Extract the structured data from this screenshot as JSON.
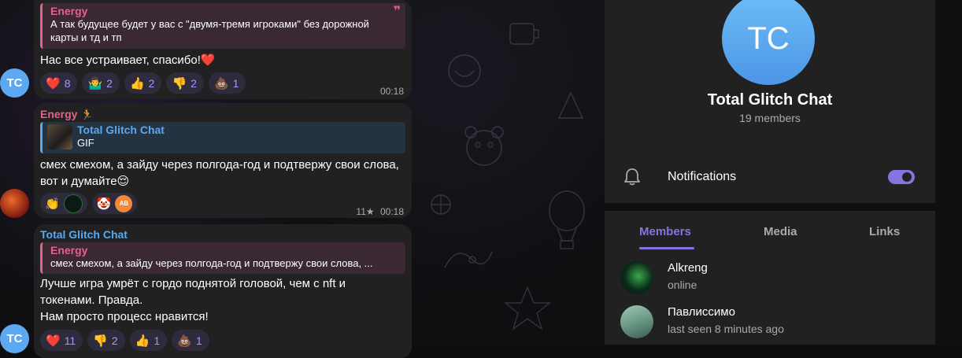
{
  "messages": [
    {
      "reply": {
        "name": "Energy",
        "text": "А так будущее будет у вас с \"двумя-тремя игроками\" без дорожной карты и тд и тп"
      },
      "text": "Нас все устраивает,  спасибо!❤️",
      "reactions": [
        {
          "emoji": "❤️",
          "count": "8"
        },
        {
          "emoji": "🤷‍♂️",
          "count": "2"
        },
        {
          "emoji": "👍",
          "count": "2"
        },
        {
          "emoji": "👎",
          "count": "2"
        },
        {
          "emoji": "💩",
          "count": "1"
        }
      ],
      "time": "00:18",
      "avatar_initials": "TC"
    },
    {
      "sender": "Energy",
      "sender_badge": "🏃",
      "reply": {
        "name": "Total Glitch Chat",
        "text": "GIF"
      },
      "text": "смех смехом, а зайду через полгода-год и подтвержу свои слова, вот и думайте😌",
      "reactions": [
        {
          "emoji": "👏"
        },
        {
          "emoji": "🤡"
        }
      ],
      "reactor_initials": "AB",
      "views": "11★",
      "time": "00:18"
    },
    {
      "sender": "Total Glitch Chat",
      "reply": {
        "name": "Energy",
        "text": "смех смехом, а зайду через полгода-год и подтвержу свои слова, ..."
      },
      "text_lines": [
        "Лучше игра умрёт с гордо поднятой головой, чем с nft и",
        "токенами. Правда.",
        "Нам просто процесс нравится!"
      ],
      "reactions": [
        {
          "emoji": "❤️",
          "count": "11"
        },
        {
          "emoji": "👎",
          "count": "2"
        },
        {
          "emoji": "👍",
          "count": "1"
        },
        {
          "emoji": "💩",
          "count": "1"
        }
      ],
      "avatar_initials": "TC"
    }
  ],
  "panel": {
    "avatar_initials": "TC",
    "title": "Total Glitch Chat",
    "subtitle": "19 members",
    "notifications_label": "Notifications",
    "notifications_on": true,
    "tabs": [
      "Members",
      "Media",
      "Links"
    ],
    "active_tab": "Members",
    "members": [
      {
        "name": "Alkreng",
        "status": "online"
      },
      {
        "name": "Павлиссимо",
        "status": "last seen 8 minutes ago"
      }
    ]
  },
  "colors": {
    "accent": "#8774e1",
    "bubble": "#212121",
    "energy_name": "#e56091",
    "channel_name": "#5aa8f0",
    "avatar_blue": "#5ca9f2"
  }
}
